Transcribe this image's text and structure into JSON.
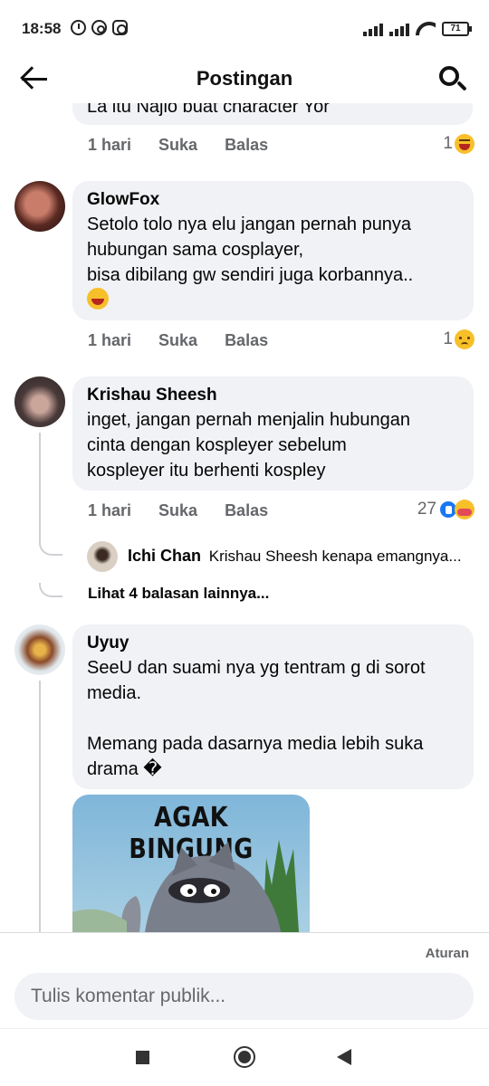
{
  "status": {
    "time": "18:58",
    "battery": "71"
  },
  "header": {
    "title": "Postingan"
  },
  "partial_comment": {
    "text": "La itu Najio buat character Yor",
    "time": "1 hari",
    "like": "Suka",
    "reply": "Balas",
    "reaction_count": "1"
  },
  "comments": [
    {
      "name": "GlowFox",
      "text": "Setolo tolo nya elu jangan pernah punya\nhubungan sama cosplayer,\nbisa dibilang gw sendiri juga korbannya..",
      "time": "1 hari",
      "like": "Suka",
      "reply": "Balas",
      "reaction_count": "1"
    },
    {
      "name": "Krishau Sheesh",
      "text": "inget, jangan pernah menjalin hubungan\ncinta dengan kospleyer sebelum\nkospleyer itu berhenti kospley",
      "time": "1 hari",
      "like": "Suka",
      "reply": "Balas",
      "reaction_count": "27",
      "reply_preview": {
        "name": "Ichi Chan",
        "text": "Krishau Sheesh kenapa emangnya..."
      },
      "more_replies": "Lihat 4 balasan lainnya..."
    },
    {
      "name": "Uyuy",
      "text": "SeeU dan suami nya yg tentram g di sorot\nmedia.\n\nMemang pada dasarnya media lebih suka\ndrama �",
      "sticker_text": "AGAK BINGUNG"
    }
  ],
  "composer": {
    "rules": "Aturan",
    "placeholder": "Tulis komentar publik..."
  },
  "colors": {
    "bubble": "#f0f2f5",
    "secondary_text": "#65676b",
    "like_blue": "#1877f2"
  }
}
